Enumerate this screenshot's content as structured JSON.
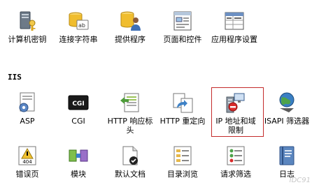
{
  "sections": {
    "top": {
      "items": [
        {
          "label": "计算机密钥",
          "icon": "machine-key-icon"
        },
        {
          "label": "连接字符串",
          "icon": "connection-strings-icon"
        },
        {
          "label": "提供程序",
          "icon": "providers-icon"
        },
        {
          "label": "页面和控件",
          "icon": "pages-controls-icon"
        },
        {
          "label": "应用程序设置",
          "icon": "app-settings-icon"
        }
      ]
    },
    "iis": {
      "title": "IIS",
      "items": [
        {
          "label": "ASP",
          "icon": "asp-icon"
        },
        {
          "label": "CGI",
          "icon": "cgi-icon"
        },
        {
          "label": "HTTP 响应标头",
          "icon": "http-response-headers-icon"
        },
        {
          "label": "HTTP 重定向",
          "icon": "http-redirect-icon"
        },
        {
          "label": "IP 地址和域限制",
          "icon": "ip-domain-restrictions-icon",
          "selected": true
        },
        {
          "label": "ISAPI 筛选器",
          "icon": "isapi-filters-icon"
        }
      ]
    },
    "bottom": {
      "items": [
        {
          "label": "错误页",
          "icon": "error-pages-icon"
        },
        {
          "label": "模块",
          "icon": "modules-icon"
        },
        {
          "label": "默认文档",
          "icon": "default-document-icon"
        },
        {
          "label": "目录浏览",
          "icon": "directory-browsing-icon"
        },
        {
          "label": "请求筛选",
          "icon": "request-filtering-icon"
        },
        {
          "label": "日志",
          "icon": "logging-icon"
        }
      ]
    }
  },
  "icon_text": {
    "cgi": "CGI",
    "error_code": "404"
  },
  "watermark": "IDC91",
  "colors": {
    "selection_border": "#c42b2b"
  }
}
